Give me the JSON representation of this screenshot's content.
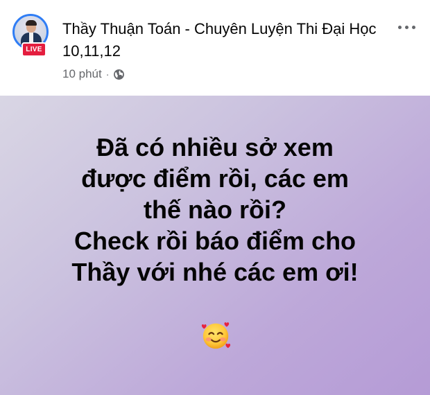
{
  "post": {
    "author": {
      "name": "Thầy Thuận Toán - Chuyên Luyện Thi Đại Học 10,11,12",
      "live_badge": "LIVE"
    },
    "meta": {
      "time": "10 phút",
      "separator": "·",
      "audience_icon": "globe-icon"
    },
    "more_icon": "more-horizontal-icon",
    "content": {
      "lines": [
        "Đã có nhiều sở xem",
        "được điểm rồi, các em",
        "thế nào rồi?",
        "Check rồi báo điểm cho",
        "Thầy với nhé các em ơi!"
      ],
      "emoji": "smiling-face-with-hearts-icon"
    },
    "colors": {
      "avatar_ring": "#2f7df5",
      "live_badge": "#e41e3f",
      "background_gradient_start": "#d9d6e4",
      "background_gradient_end": "#b59bd6",
      "meta_text": "#65676b"
    }
  }
}
